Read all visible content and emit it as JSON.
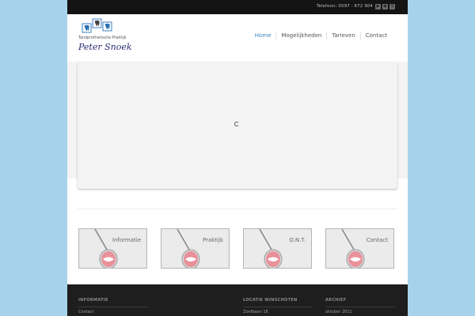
{
  "topbar": {
    "phone": "Telefoon: 0597 - 672 904",
    "social_icons": [
      "youtube-icon",
      "rss-icon",
      "skype-icon"
    ]
  },
  "logo": {
    "subtitle": "Tandprothetische Praktijk",
    "name": "Peter Snoek"
  },
  "nav": {
    "items": [
      {
        "label": "Home",
        "active": true
      },
      {
        "label": "Mogelijkheden",
        "active": false
      },
      {
        "label": "Tarieven",
        "active": false
      },
      {
        "label": "Contact",
        "active": false
      }
    ]
  },
  "tiles": [
    {
      "label": "Informatie"
    },
    {
      "label": "Praktijk"
    },
    {
      "label": "O.N.T."
    },
    {
      "label": "Contact"
    }
  ],
  "footer": {
    "columns": [
      {
        "heading": "INFORMATIE",
        "items": [
          "Contact"
        ]
      },
      {
        "heading": "LOCATIE WINSCHOTEN",
        "items": [
          "Zoefbaan 16"
        ]
      },
      {
        "heading": "ARCHIEF",
        "items": [
          "oktober 2011"
        ]
      }
    ]
  },
  "colors": {
    "background": "#a6d3ea",
    "topbar": "#141414",
    "nav_active": "#3b88c4",
    "logo_name": "#2c2c76",
    "footer": "#1e1e1e"
  }
}
